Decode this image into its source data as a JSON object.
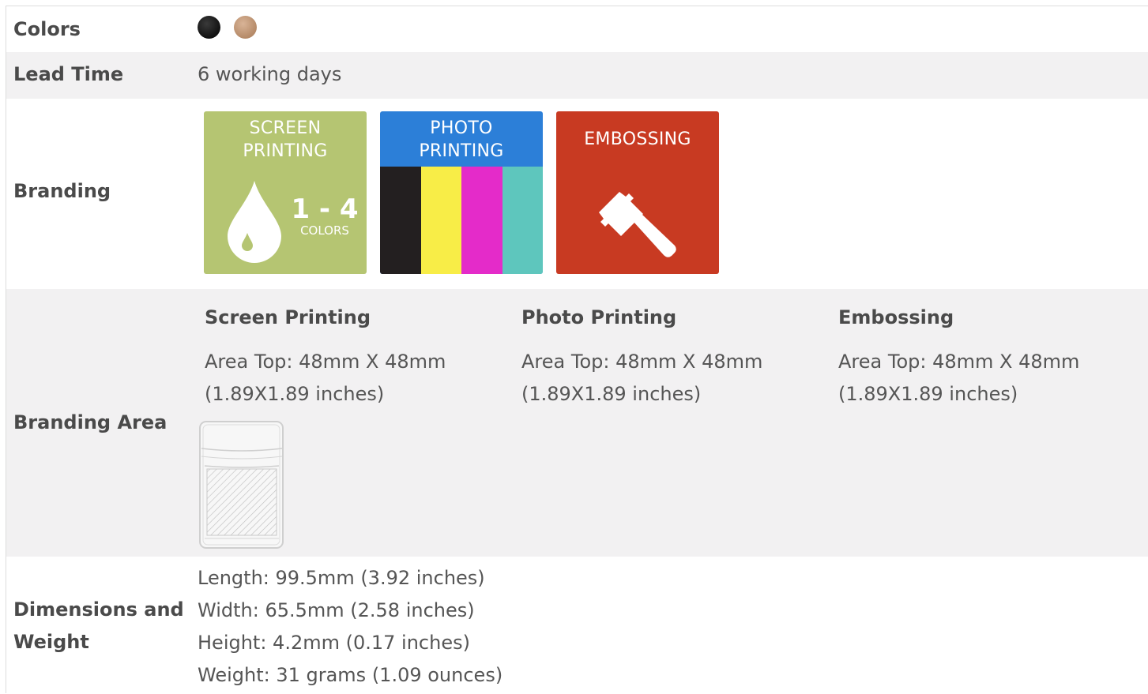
{
  "rows": {
    "colors": {
      "label": "Colors",
      "swatches": [
        {
          "name": "black",
          "color": "#1a1a1a"
        },
        {
          "name": "tan",
          "color": "#c49a7a"
        }
      ]
    },
    "lead_time": {
      "label": "Lead Time",
      "value": "6 working days"
    },
    "branding": {
      "label": "Branding",
      "badges": [
        {
          "title_line1": "SCREEN",
          "title_line2": "PRINTING",
          "count": "1 - 4",
          "count_sub": "COLORS",
          "color": "#b5c572",
          "icon": "ink-drop-icon"
        },
        {
          "title_line1": "PHOTO",
          "title_line2": "PRINTING",
          "color": "#2c7fd8",
          "icon": "cmyk-bars-icon",
          "bars": [
            "#231f20",
            "#f8ed47",
            "#e42bc9",
            "#5ec6bd"
          ]
        },
        {
          "title": "EMBOSSING",
          "color": "#c83a22",
          "icon": "hammer-icon"
        }
      ]
    },
    "branding_area": {
      "label": "Branding Area",
      "methods": [
        {
          "title": "Screen Printing",
          "text_line1": "Area Top: 48mm X 48mm",
          "text_line2": "(1.89X1.89 inches)"
        },
        {
          "title": "Photo Printing",
          "text_line1": "Area Top: 48mm X 48mm",
          "text_line2": "(1.89X1.89 inches)"
        },
        {
          "title": "Embossing",
          "text_line1": "Area Top: 48mm X 48mm",
          "text_line2": "(1.89X1.89 inches)"
        }
      ]
    },
    "dimensions": {
      "label_line1": "Dimensions and",
      "label_line2": "Weight",
      "lines": [
        "Length: 99.5mm (3.92 inches)",
        "Width: 65.5mm (2.58 inches)",
        "Height: 4.2mm (0.17 inches)",
        "Weight: 31 grams (1.09 ounces)"
      ]
    }
  }
}
